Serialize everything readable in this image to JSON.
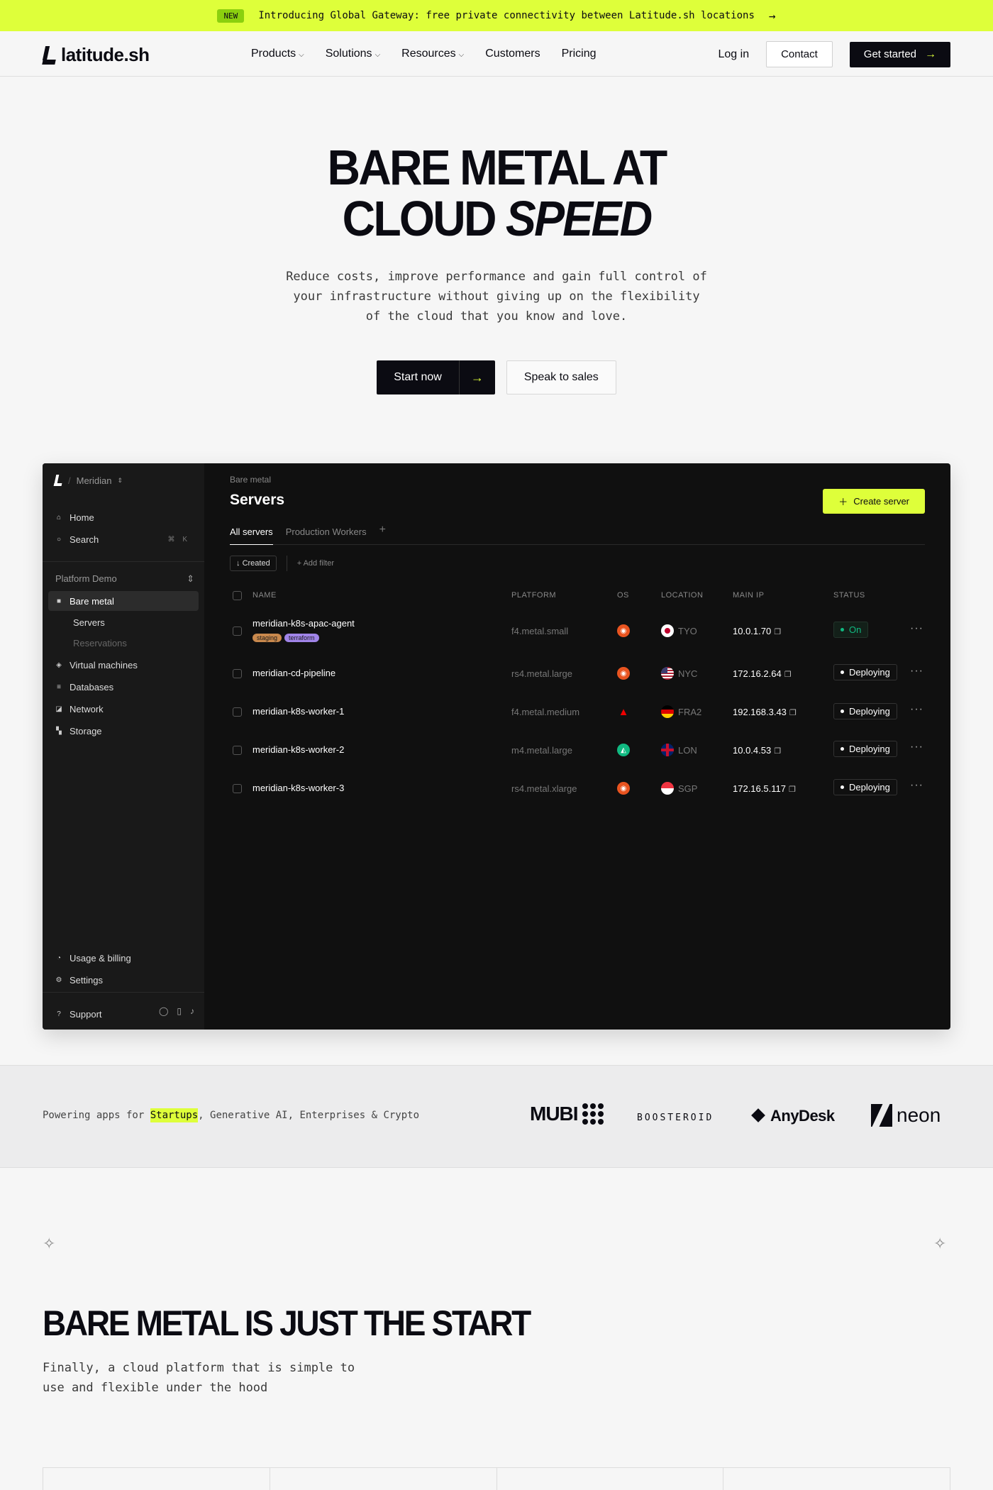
{
  "announce": {
    "badge": "NEW",
    "text": "Introducing Global Gateway: free private connectivity between Latitude.sh locations",
    "arrow": "→"
  },
  "nav": {
    "logo": "latitude.sh",
    "links": [
      "Products",
      "Solutions",
      "Resources",
      "Customers",
      "Pricing"
    ],
    "login": "Log in",
    "contact": "Contact",
    "get_started": "Get started"
  },
  "hero": {
    "title_line1": "BARE METAL AT",
    "title_line2_a": "CLOUD",
    "title_line2_b": "SPEED",
    "subtitle": "Reduce costs, improve performance and gain full control of your infrastructure without giving up on the flexibility of the cloud that you know and love.",
    "primary_cta": "Start now",
    "secondary_cta": "Speak to sales"
  },
  "dashboard": {
    "workspace": "Meridian",
    "sidebar": {
      "home": "Home",
      "search": "Search",
      "search_kbd": "⌘ K",
      "group": "Platform Demo",
      "bare_metal": "Bare metal",
      "servers": "Servers",
      "reservations": "Reservations",
      "vms": "Virtual machines",
      "databases": "Databases",
      "network": "Network",
      "storage": "Storage",
      "usage": "Usage & billing",
      "settings": "Settings",
      "support": "Support"
    },
    "breadcrumb": "Bare metal",
    "title": "Servers",
    "create_btn": "Create server",
    "tabs": [
      "All servers",
      "Production Workers"
    ],
    "filter_created": "Created",
    "filter_add": "Add filter",
    "columns": [
      "NAME",
      "PLATFORM",
      "OS",
      "LOCATION",
      "MAIN IP",
      "STATUS"
    ],
    "rows": [
      {
        "name": "meridian-k8s-apac-agent",
        "tags": [
          "staging",
          "terraform"
        ],
        "platform": "f4.metal.small",
        "os": "ubuntu-icon",
        "location": "TYO",
        "ip": "10.0.1.70",
        "status": "On"
      },
      {
        "name": "meridian-cd-pipeline",
        "platform": "rs4.metal.large",
        "os": "ubuntu-icon",
        "location": "NYC",
        "ip": "172.16.2.64",
        "status": "Deploying"
      },
      {
        "name": "meridian-k8s-worker-1",
        "platform": "f4.metal.medium",
        "os": "redhat-icon",
        "location": "FRA2",
        "ip": "192.168.3.43",
        "status": "Deploying"
      },
      {
        "name": "meridian-k8s-worker-2",
        "platform": "m4.metal.large",
        "os": "rocky-icon",
        "location": "LON",
        "ip": "10.0.4.53",
        "status": "Deploying"
      },
      {
        "name": "meridian-k8s-worker-3",
        "platform": "rs4.metal.xlarge",
        "os": "ubuntu-icon",
        "location": "SGP",
        "ip": "172.16.5.117",
        "status": "Deploying"
      }
    ]
  },
  "logos_band": {
    "text_prefix": "Powering apps for ",
    "highlight": "Startups",
    "text_suffix": ", Generative AI, Enterprises & Crypto",
    "brands": [
      "MUBI",
      "BOOSTEROID",
      "AnyDesk",
      "neon"
    ]
  },
  "section2": {
    "title": "BARE METAL IS JUST THE START",
    "subtitle": "Finally, a cloud platform that is simple to use and flexible under the hood"
  },
  "colors": {
    "accent": "#deff3a",
    "dark": "#0b0b12",
    "ubuntu": "#e95420",
    "status_on": "#10b981"
  }
}
